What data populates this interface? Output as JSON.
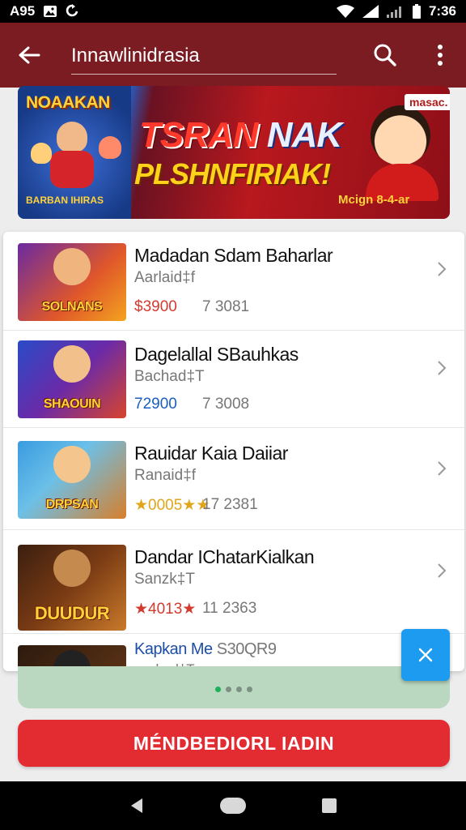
{
  "status_bar": {
    "left_text": "A95",
    "time": "7:36",
    "icons": [
      "photo-icon",
      "sync-icon",
      "wifi-icon",
      "signal-icon",
      "battery-icon"
    ]
  },
  "app_bar": {
    "title": "Innawlinidrasia",
    "back_icon": "arrow-left-icon",
    "search_icon": "search-icon",
    "more_icon": "more-vertical-icon",
    "color": "#7a1c22"
  },
  "banner": {
    "poster_title": "NOAAKAN",
    "poster_sub": "BARBAN IHIRAS",
    "headline_1a": "TSRAN",
    "headline_1b": " NAK",
    "headline_2": "PLSHNFIRIAK!",
    "badge": "masac.",
    "footer": "Mcign 8-4-ar"
  },
  "games": [
    {
      "title": "Madadan Sdam Baharlar",
      "subtitle": "Aarlaid‡f",
      "price": "$3900",
      "price_color": "#d33b2f",
      "count": "7 3081",
      "thumb_text": "SOLNANS",
      "thumb_bg": "linear-gradient(135deg,#6a2aa0,#e0572a 60%,#f3a31f)",
      "hero_color": "#f0b47e"
    },
    {
      "title": "Dagelallal SBauhkas",
      "subtitle": "Bachad‡T",
      "price": "72900",
      "price_color": "#1a5fbf",
      "count": "7 3008",
      "thumb_text": "SHAOUIN",
      "thumb_bg": "linear-gradient(135deg,#2a4bc8,#6b2aa8 50%,#d8452a)",
      "hero_color": "#f2c08a"
    },
    {
      "title": "Rauidar Kaia Daiiar",
      "subtitle": "Ranaid‡f",
      "price": "★0005★★",
      "price_color": "#e0a51a",
      "count": "17 2381",
      "thumb_text": "DRPSAN",
      "thumb_bg": "linear-gradient(135deg,#3a9be0,#6cc0e8 40%,#d87f2a)",
      "hero_color": "#f4c68e"
    },
    {
      "title": "Dandar IChatarKialkan",
      "subtitle": "Sanzk‡T",
      "price": "★4013★",
      "price_color": "#d33b2f",
      "count": "11 2363",
      "thumb_text": "DUUDUR",
      "thumb_bg": "linear-gradient(135deg,#3b1f10,#7a3b14 50%,#c97a2a)",
      "hero_color": "#c48a4e"
    },
    {
      "title": "Kapkan Me",
      "title_extra": " S30QR9",
      "subtitle": "vachad‡T",
      "thumb_text": "",
      "thumb_bg": "linear-gradient(135deg,#2c1a0e,#6b3a18)",
      "hero_color": "#222"
    }
  ],
  "pager": {
    "dots": 4,
    "active": 0
  },
  "fab": {
    "icon": "close-icon",
    "color": "#1d9bf0"
  },
  "cta": {
    "label": "MÉNDBEDIORL IADIN",
    "color": "#e32b32"
  },
  "nav_bar": {
    "back_icon": "nav-back-icon",
    "home_icon": "nav-home-icon",
    "recents_icon": "nav-recents-icon"
  }
}
